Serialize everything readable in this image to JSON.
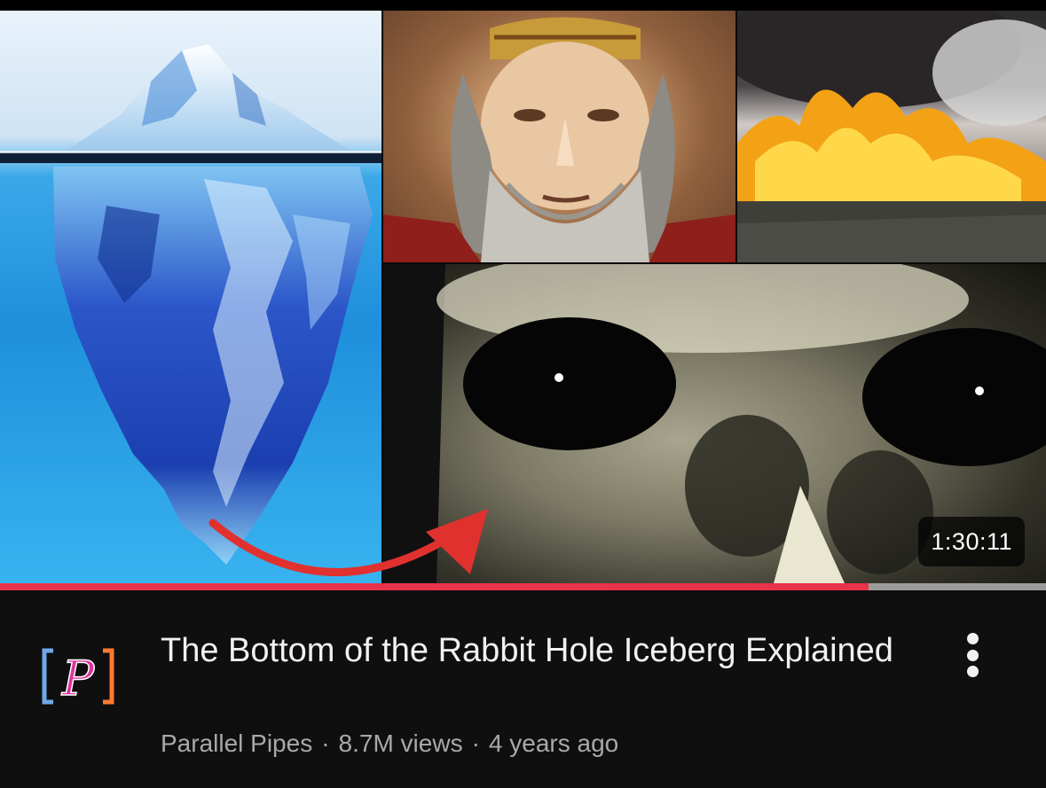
{
  "video": {
    "title": "The Bottom of the Rabbit Hole Iceberg Explained",
    "duration": "1:30:11",
    "channel": "Parallel Pipes",
    "views": "8.7M views",
    "age": "4 years ago",
    "separator": "·",
    "watch_progress": 0.83
  },
  "channel_avatar": {
    "icon": "parallel-pipes-logo-icon",
    "letter": "P"
  },
  "thumbnail": {
    "panels": [
      "iceberg-image",
      "bearded-man-image",
      "fire-smoke-image",
      "dark-eyes-image"
    ],
    "arrow_icon": "curved-red-arrow-icon"
  },
  "more_menu": {
    "icon": "three-dots-vertical-icon"
  },
  "colors": {
    "background": "#0f0f0f",
    "title": "#f1f1f1",
    "meta": "#a9a9a9",
    "progress_fill": "#e8334a",
    "progress_track": "#9c9c9c",
    "arrow": "#e0312f",
    "logo_pink": "#e0319c",
    "logo_bracket_left": "#6fa8e8",
    "logo_bracket_right": "#ff7a2f"
  }
}
